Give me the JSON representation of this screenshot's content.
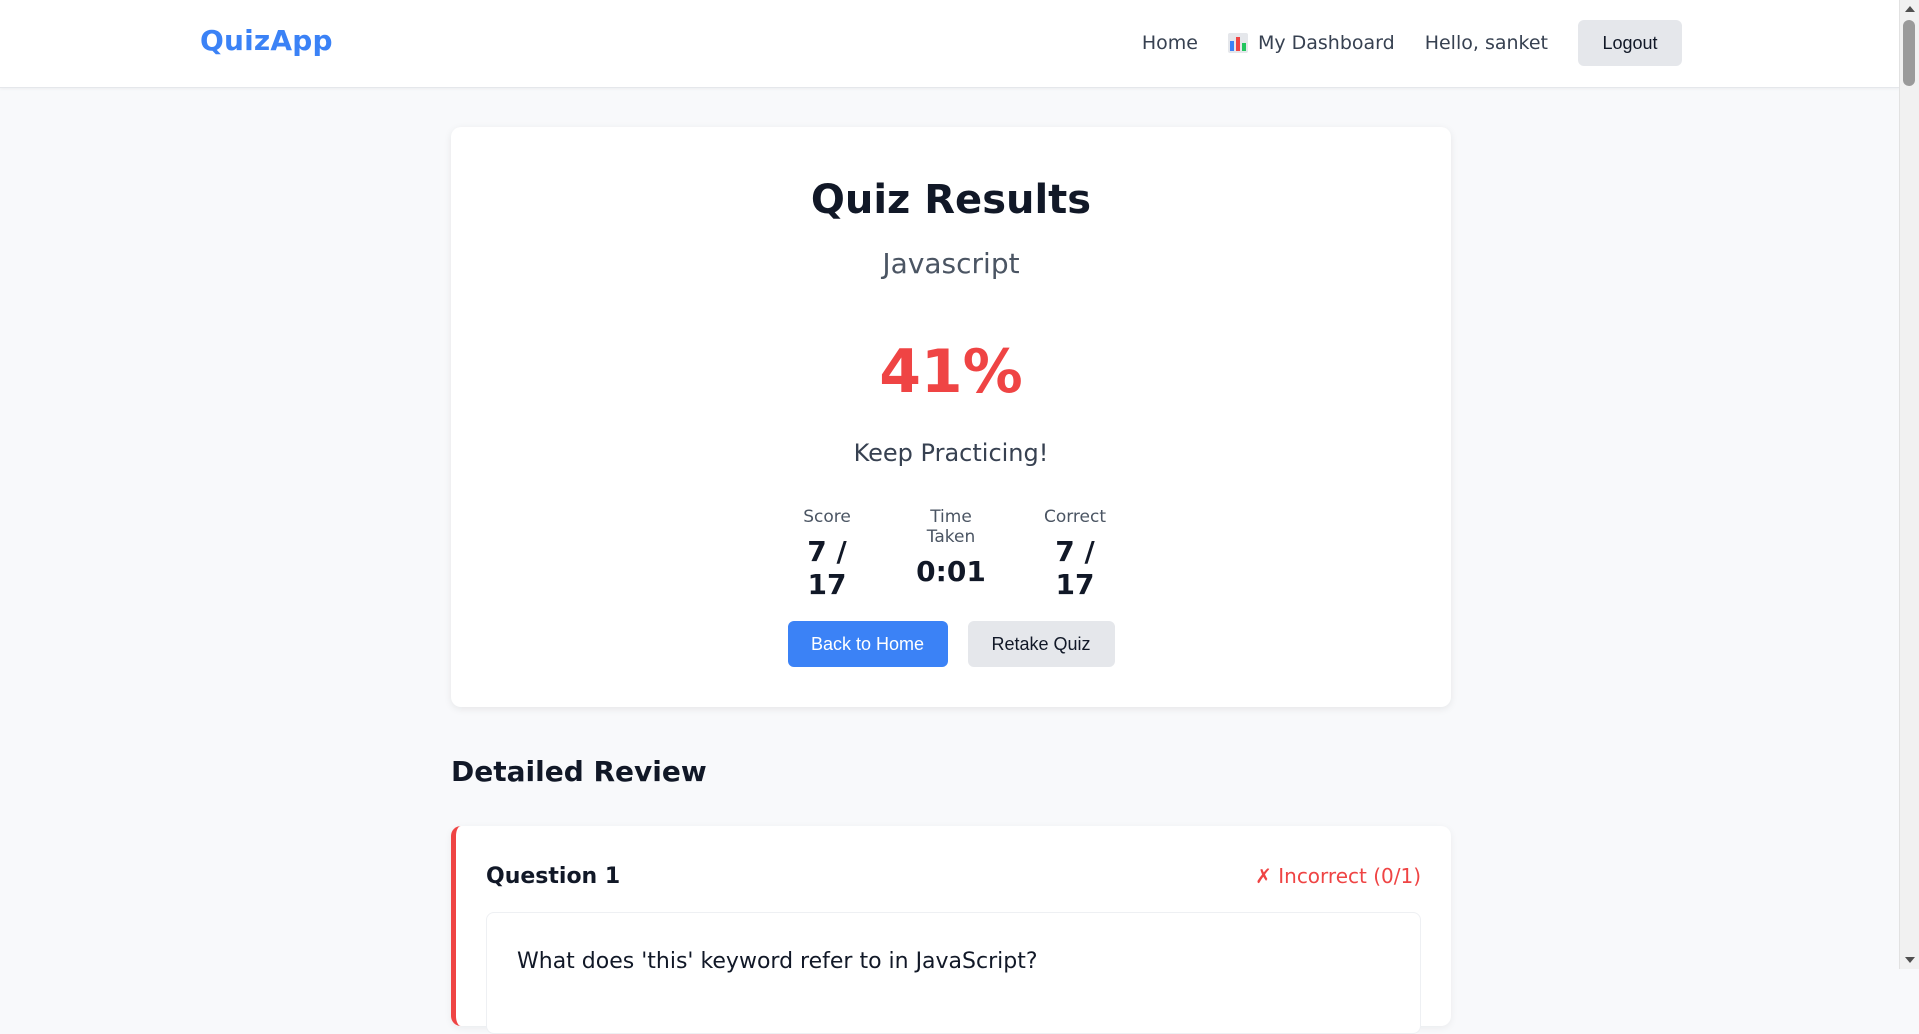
{
  "navbar": {
    "brand": "QuizApp",
    "home_label": "Home",
    "dashboard_label": "My Dashboard",
    "dashboard_icon": "bar-chart-icon",
    "greeting": "Hello, sanket",
    "logout_label": "Logout"
  },
  "results": {
    "title": "Quiz Results",
    "topic": "Javascript",
    "percent": "41%",
    "message": "Keep Practicing!",
    "stats": [
      {
        "label": "Score",
        "value": "7 / 17"
      },
      {
        "label": "Time Taken",
        "value": "0:01"
      },
      {
        "label": "Correct",
        "value": "7 / 17"
      }
    ],
    "back_label": "Back to Home",
    "retake_label": "Retake Quiz"
  },
  "review": {
    "heading": "Detailed Review",
    "questions": [
      {
        "number": "Question 1",
        "status": "✗ Incorrect (0/1)",
        "text": "What does 'this' keyword refer to in JavaScript?"
      }
    ]
  },
  "colors": {
    "brand": "#3b82f6",
    "primary_button": "#3b82f6",
    "secondary_button": "#e5e7eb",
    "percent_red": "#ef4444",
    "incorrect_red": "#ef4444",
    "page_background": "#f8f9fb"
  }
}
